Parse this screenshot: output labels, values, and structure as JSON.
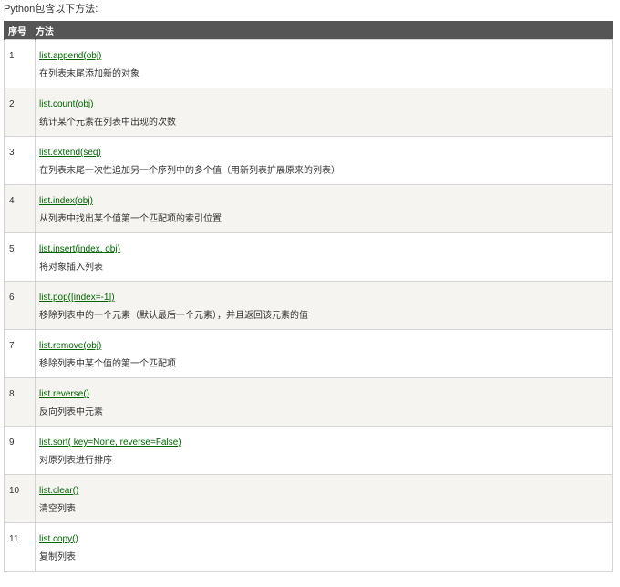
{
  "intro": "Python包含以下方法:",
  "table": {
    "headers": [
      "序号",
      "方法"
    ],
    "rows": [
      {
        "num": "1",
        "method": "list.append(obj)",
        "desc": "在列表末尾添加新的对象"
      },
      {
        "num": "2",
        "method": "list.count(obj)",
        "desc": "统计某个元素在列表中出现的次数"
      },
      {
        "num": "3",
        "method": "list.extend(seq)",
        "desc": "在列表末尾一次性追加另一个序列中的多个值（用新列表扩展原来的列表）"
      },
      {
        "num": "4",
        "method": "list.index(obj)",
        "desc": "从列表中找出某个值第一个匹配项的索引位置"
      },
      {
        "num": "5",
        "method": "list.insert(index, obj)",
        "desc": "将对象插入列表"
      },
      {
        "num": "6",
        "method": "list.pop([index=-1])",
        "desc": "移除列表中的一个元素（默认最后一个元素），并且返回该元素的值"
      },
      {
        "num": "7",
        "method": "list.remove(obj)",
        "desc": "移除列表中某个值的第一个匹配项"
      },
      {
        "num": "8",
        "method": "list.reverse()",
        "desc": "反向列表中元素"
      },
      {
        "num": "9",
        "method": "list.sort( key=None, reverse=False)",
        "desc": "对原列表进行排序"
      },
      {
        "num": "10",
        "method": "list.clear()",
        "desc": "清空列表"
      },
      {
        "num": "11",
        "method": "list.copy()",
        "desc": "复制列表"
      }
    ]
  },
  "colors": {
    "header_bg": "#555555",
    "link": "#006600",
    "even_row": "#f6f4f0"
  }
}
